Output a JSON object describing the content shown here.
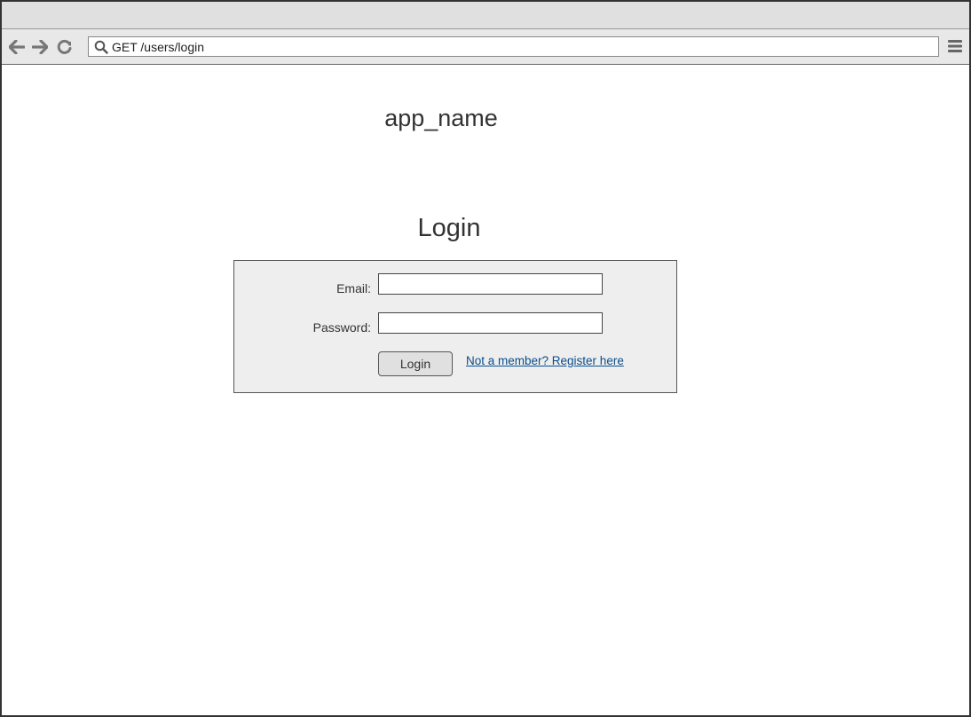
{
  "browser": {
    "url": "GET /users/login",
    "icons": {
      "back": "arrow-left-icon",
      "forward": "arrow-right-icon",
      "reload": "reload-icon",
      "search": "search-icon",
      "menu": "hamburger-menu-icon"
    }
  },
  "page": {
    "app_name": "app_name",
    "heading": "Login"
  },
  "form": {
    "email_label": "Email:",
    "email_value": "",
    "password_label": "Password:",
    "password_value": "",
    "submit_label": "Login",
    "register_link": "Not a member? Register here"
  },
  "colors": {
    "link": "#0a4d8c",
    "form_background": "#eeeeee",
    "chrome_background": "#e8e8e8"
  }
}
